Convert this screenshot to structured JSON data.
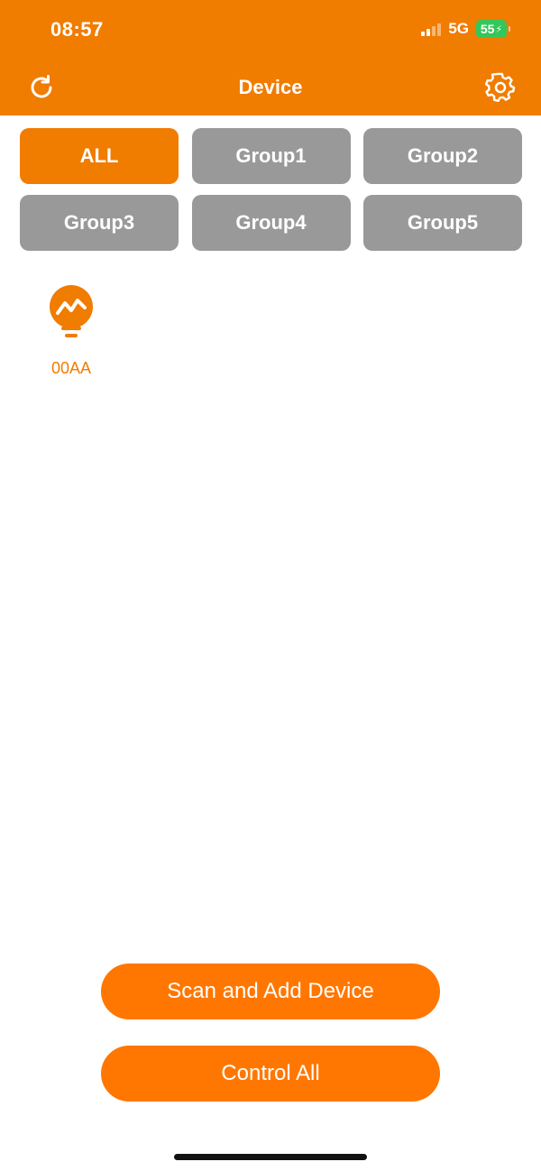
{
  "status_bar": {
    "time": "08:57",
    "network": "5G",
    "battery": "55"
  },
  "header": {
    "title": "Device",
    "refresh_icon": "refresh-icon",
    "settings_icon": "gear-icon"
  },
  "groups": [
    {
      "label": "ALL",
      "active": true
    },
    {
      "label": "Group1",
      "active": false
    },
    {
      "label": "Group2",
      "active": false
    },
    {
      "label": "Group3",
      "active": false
    },
    {
      "label": "Group4",
      "active": false
    },
    {
      "label": "Group5",
      "active": false
    }
  ],
  "devices": [
    {
      "label": "00AA",
      "icon": "bulb-icon"
    }
  ],
  "actions": {
    "scan_label": "Scan and Add Device",
    "control_label": "Control All"
  },
  "colors": {
    "accent": "#F07C00",
    "button_orange": "#FF7700",
    "inactive_gray": "#999999",
    "battery_green": "#34C759"
  }
}
